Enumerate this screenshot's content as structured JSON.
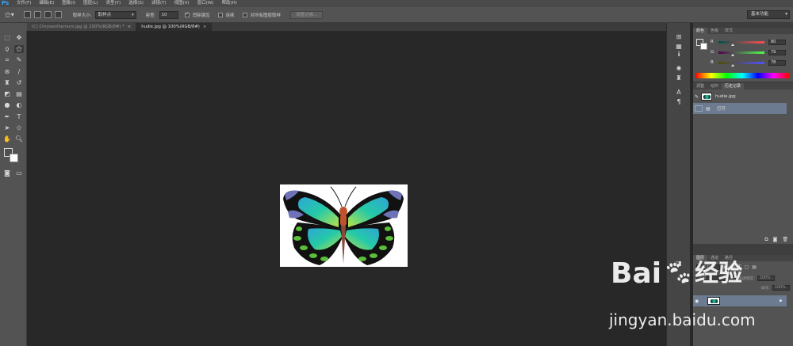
{
  "app": {
    "logo": "Ps"
  },
  "menu": [
    "文件(F)",
    "编辑(E)",
    "图像(I)",
    "图层(L)",
    "类型(Y)",
    "选择(S)",
    "滤镜(T)",
    "视图(V)",
    "窗口(W)",
    "帮助(H)"
  ],
  "options": {
    "sample_size_label": "取样大小:",
    "sample_size_value": "取样点",
    "tolerance_label": "容差:",
    "tolerance_value": "10",
    "antialias_label": "消除锯齿",
    "contiguous_label": "连续",
    "sample_all_label": "对所有图层取样",
    "refine_edge_label": "调整边缘..."
  },
  "workspace": "基本功能",
  "tabs": [
    {
      "label": "(C) Chrysanthemum.jpg @ 100%(RGB/8#) *",
      "close": "×"
    },
    {
      "label": "hudie.jpg @ 100%(RGB/8#)",
      "close": "×"
    }
  ],
  "color_panel": {
    "tabs": [
      "颜色",
      "色板",
      "样式"
    ],
    "r_label": "R",
    "r_value": "80",
    "g_label": "G",
    "g_value": "79",
    "b_label": "B",
    "b_value": "78",
    "r_fraction": 0.314,
    "g_fraction": 0.31,
    "b_fraction": 0.306
  },
  "history_panel": {
    "tabs": [
      "调整",
      "动作",
      "历史记录"
    ],
    "snapshot_label": "hudie.jpg",
    "items": [
      "打开"
    ]
  },
  "layers_panel": {
    "tabs": [
      "图层",
      "通道",
      "路径"
    ],
    "kind_label": "ρ 类型",
    "blend_mode": "正常",
    "opacity_label": "不透明度:",
    "opacity_value": "100%",
    "fill_label": "填充:",
    "fill_value": "100%"
  },
  "watermark": {
    "brand": "Bai",
    "brand_cn": "经验",
    "url": "jingyan.baidu.com"
  },
  "colors": {
    "menubar": "#4a4a4a",
    "optionsbar": "#535353",
    "canvas": "#282828",
    "panel": "#535353",
    "history_selected": "#6c7b8f",
    "ps_blue": "#31a8ff"
  }
}
